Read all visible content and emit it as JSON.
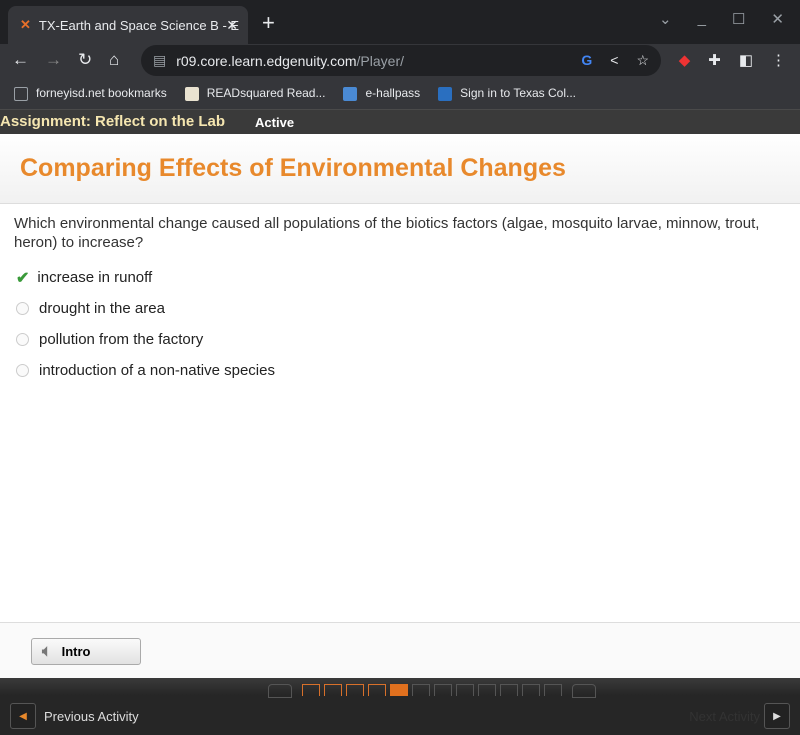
{
  "browser": {
    "tab_title": "TX-Earth and Space Science B - E",
    "url_host": "r09.core.learn.edgenuity.com",
    "url_path": "/Player/",
    "bookmarks": [
      {
        "label": "forneyisd.net bookmarks",
        "color": "#9aa0a6"
      },
      {
        "label": "READsquared Read...",
        "color": "#e9e2d0"
      },
      {
        "label": "e-hallpass",
        "color": "#4a8ad4"
      },
      {
        "label": "Sign in to Texas Col...",
        "color": "#2a6fc0"
      }
    ]
  },
  "assignment": {
    "title": "Assignment: Reflect on the Lab",
    "status": "Active"
  },
  "lesson": {
    "title": "Comparing Effects of Environmental Changes",
    "question": "Which environmental change caused all populations of the biotics factors (algae, mosquito larvae, minnow, trout, heron) to increase?",
    "question_line1": "Which environmental change caused all populations of the biotics factors (algae, mosquito larvae, minnow, trout,",
    "question_line2": "heron) to increase?",
    "options": [
      {
        "label": "increase in runoff",
        "selected": true
      },
      {
        "label": "drought in the area",
        "selected": false
      },
      {
        "label": "pollution from the factory",
        "selected": false
      },
      {
        "label": "introduction of a non-native species",
        "selected": false
      }
    ]
  },
  "footer": {
    "intro_label": "Intro"
  },
  "nav": {
    "prev_label": "Previous Activity",
    "next_label": "Next Activity",
    "pages_total": 12,
    "pages_done": 4,
    "current_page": 5,
    "accent": "#e0701e"
  }
}
